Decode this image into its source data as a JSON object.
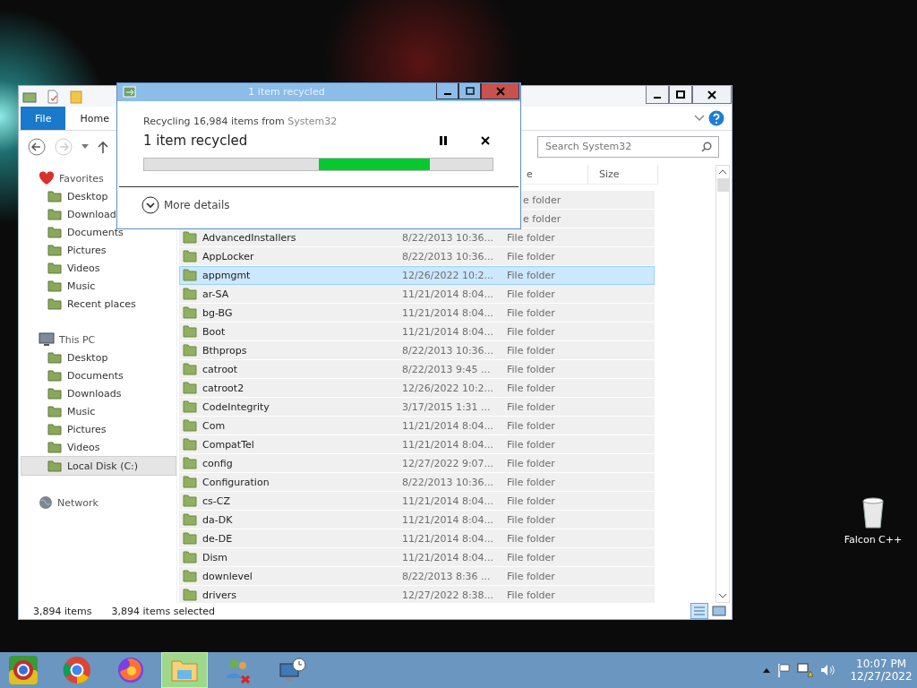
{
  "explorer": {
    "ribbon_tabs": [
      {
        "label": "File",
        "selected": true
      },
      {
        "label": "Home",
        "selected": false
      }
    ],
    "search": {
      "placeholder": "Search System32"
    },
    "sidebar": [
      {
        "label": "Favorites",
        "children": [
          {
            "label": "Desktop",
            "selected": false
          },
          {
            "label": "Download",
            "selected": false
          },
          {
            "label": "Documents",
            "selected": false
          },
          {
            "label": "Pictures",
            "selected": false
          },
          {
            "label": "Videos",
            "selected": false
          },
          {
            "label": "Music",
            "selected": false
          },
          {
            "label": "Recent places",
            "selected": false
          }
        ]
      },
      {
        "label": "This PC",
        "children": [
          {
            "label": "Desktop",
            "selected": false
          },
          {
            "label": "Documents",
            "selected": false
          },
          {
            "label": "Downloads",
            "selected": false
          },
          {
            "label": "Music",
            "selected": false
          },
          {
            "label": "Pictures",
            "selected": false
          },
          {
            "label": "Videos",
            "selected": false
          },
          {
            "label": "Local Disk (C:)",
            "selected": true
          }
        ]
      },
      {
        "label": "Network"
      }
    ],
    "table": {
      "columns": [
        "e",
        "Size"
      ],
      "rows": [
        {
          "type": "e folder",
          "selected": false
        },
        {
          "type": "e folder",
          "selected": false
        },
        {
          "name": "AdvancedInstallers",
          "date": "8/22/2013 10:36...",
          "type": "File folder",
          "selected": false
        },
        {
          "name": "AppLocker",
          "date": "8/22/2013 10:36...",
          "type": "File folder",
          "selected": false
        },
        {
          "name": "appmgmt",
          "date": "12/26/2022 10:2...",
          "type": "File folder",
          "selected": true
        },
        {
          "name": "ar-SA",
          "date": "11/21/2014 8:04...",
          "type": "File folder",
          "selected": false
        },
        {
          "name": "bg-BG",
          "date": "11/21/2014 8:04...",
          "type": "File folder",
          "selected": false
        },
        {
          "name": "Boot",
          "date": "11/21/2014 8:04...",
          "type": "File folder",
          "selected": false
        },
        {
          "name": "Bthprops",
          "date": "8/22/2013 10:36...",
          "type": "File folder",
          "selected": false
        },
        {
          "name": "catroot",
          "date": "8/22/2013 9:45 ...",
          "type": "File folder",
          "selected": false
        },
        {
          "name": "catroot2",
          "date": "12/26/2022 10:2...",
          "type": "File folder",
          "selected": false
        },
        {
          "name": "CodeIntegrity",
          "date": "3/17/2015 1:31 ...",
          "type": "File folder",
          "selected": false
        },
        {
          "name": "Com",
          "date": "11/21/2014 8:04...",
          "type": "File folder",
          "selected": false
        },
        {
          "name": "CompatTel",
          "date": "11/21/2014 8:04...",
          "type": "File folder",
          "selected": false
        },
        {
          "name": "config",
          "date": "12/27/2022 9:07...",
          "type": "File folder",
          "selected": false
        },
        {
          "name": "Configuration",
          "date": "8/22/2013 10:36...",
          "type": "File folder",
          "selected": false
        },
        {
          "name": "cs-CZ",
          "date": "11/21/2014 8:04...",
          "type": "File folder",
          "selected": false
        },
        {
          "name": "da-DK",
          "date": "11/21/2014 8:04...",
          "type": "File folder",
          "selected": false
        },
        {
          "name": "de-DE",
          "date": "11/21/2014 8:04...",
          "type": "File folder",
          "selected": false
        },
        {
          "name": "Dism",
          "date": "11/21/2014 8:04...",
          "type": "File folder",
          "selected": false
        },
        {
          "name": "downlevel",
          "date": "8/22/2013 8:36 ...",
          "type": "File folder",
          "selected": false
        },
        {
          "name": "drivers",
          "date": "12/27/2022 8:38...",
          "type": "File folder",
          "selected": false
        }
      ]
    },
    "status_bar": {
      "count": "3,894 items",
      "selection": "3,894 items selected"
    }
  },
  "dialog": {
    "title": "1 item recycled",
    "line_prefix": "Recycling 16,984 items from ",
    "line_source": "System32",
    "heading": "1 item recycled",
    "details": "More details"
  },
  "desktop_icons": [
    {
      "label": "Falcon C++"
    }
  ],
  "taskbar": {
    "buttons": [
      {
        "selected": false
      },
      {
        "selected": false
      },
      {
        "selected": false
      },
      {
        "selected": true
      },
      {
        "selected": false
      },
      {
        "selected": false
      }
    ],
    "time": "10:07 PM",
    "date": "12/27/2022"
  }
}
